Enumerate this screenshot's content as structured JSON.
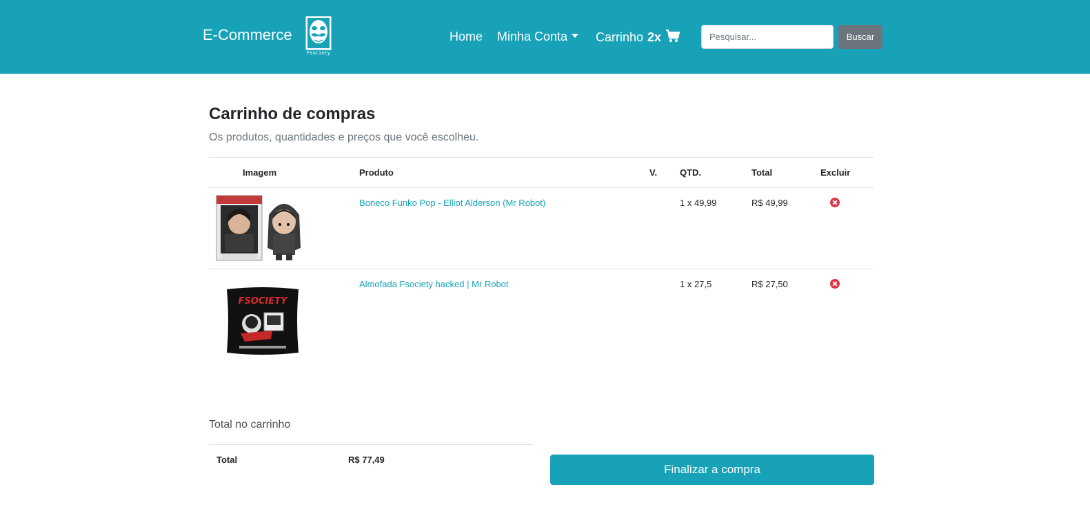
{
  "navbar": {
    "brand": "E-Commerce",
    "logo_text": "Fsociety",
    "home": "Home",
    "account": "Minha Conta",
    "cart_label": "Carrinho",
    "cart_count": "2x",
    "cart_icon": "shopping-cart-icon",
    "search_placeholder": "Pesquisar...",
    "search_button": "Buscar",
    "color": "#17a2b8"
  },
  "page": {
    "title": "Carrinho de compras",
    "subtitle": "Os produtos, quantidades e preços que você escolheu."
  },
  "table": {
    "headers": {
      "image": "Imagem",
      "product": "Produto",
      "variant": "V.",
      "quantity": "QTD.",
      "total": "Total",
      "remove": "Excluir"
    },
    "rows": [
      {
        "image_alt": "Funko Pop Elliot Alderson",
        "product": "Boneco Funko Pop - Elliot Alderson (Mr Robot)",
        "quantity": "1 x 49,99",
        "total": "R$ 49,99",
        "remove_icon": "remove-circle-icon"
      },
      {
        "image_alt": "Almofada Fsociety",
        "image_text": "FSOCIETY",
        "product": "Almofada Fsociety hacked | Mr Robot",
        "quantity": "1 x 27,5",
        "total": "R$ 27,50",
        "remove_icon": "remove-circle-icon"
      }
    ]
  },
  "summary": {
    "title": "Total no carrinho",
    "total_label": "Total",
    "total_value": "R$ 77,49",
    "checkout_button": "Finalizar a compra"
  }
}
